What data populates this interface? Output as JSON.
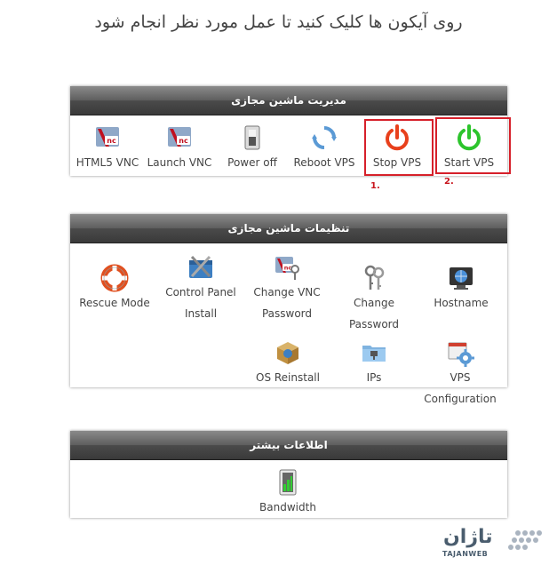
{
  "instruction": "روی آیکون ها کلیک کنید تا عمل مورد نظر انجام شود",
  "panels": {
    "manage": {
      "title": "مدیریت ماشین مجازی",
      "items": [
        {
          "label": "HTML5 VNC",
          "icon": "vnc-icon"
        },
        {
          "label": "Launch VNC",
          "icon": "vnc-icon"
        },
        {
          "label": "Power off",
          "icon": "power-switch-icon"
        },
        {
          "label": "Reboot VPS",
          "icon": "reboot-icon"
        },
        {
          "label": "Stop VPS",
          "icon": "power-icon",
          "color": "#e8401c"
        },
        {
          "label": "Start VPS",
          "icon": "power-icon",
          "color": "#2cc42c"
        }
      ]
    },
    "settings": {
      "title": "تنظیمات ماشین مجازی",
      "items": [
        {
          "label": "Rescue Mode",
          "icon": "lifebuoy-icon"
        },
        {
          "label": "Control Panel Install",
          "icon": "tools-icon"
        },
        {
          "label": "Change VNC Password",
          "icon": "vnc-key-icon"
        },
        {
          "label": "Change Password",
          "icon": "keys-icon"
        },
        {
          "label": "Hostname",
          "icon": "monitor-globe-icon"
        },
        {
          "label": "OS Reinstall",
          "icon": "box-icon"
        },
        {
          "label": "IPs",
          "icon": "network-folder-icon"
        },
        {
          "label": "VPS Configuration",
          "icon": "gear-window-icon"
        }
      ]
    },
    "more": {
      "title": "اطلاعات بیشتر",
      "items": [
        {
          "label": "Bandwidth",
          "icon": "bandwidth-icon"
        }
      ]
    }
  },
  "annotations": {
    "stop": "1.",
    "start": "2."
  },
  "logo": {
    "name": "تاژان",
    "sub": "TAJANWEB"
  },
  "colors": {
    "highlight": "#d6202a",
    "header_dark": "#3a3a3a"
  }
}
